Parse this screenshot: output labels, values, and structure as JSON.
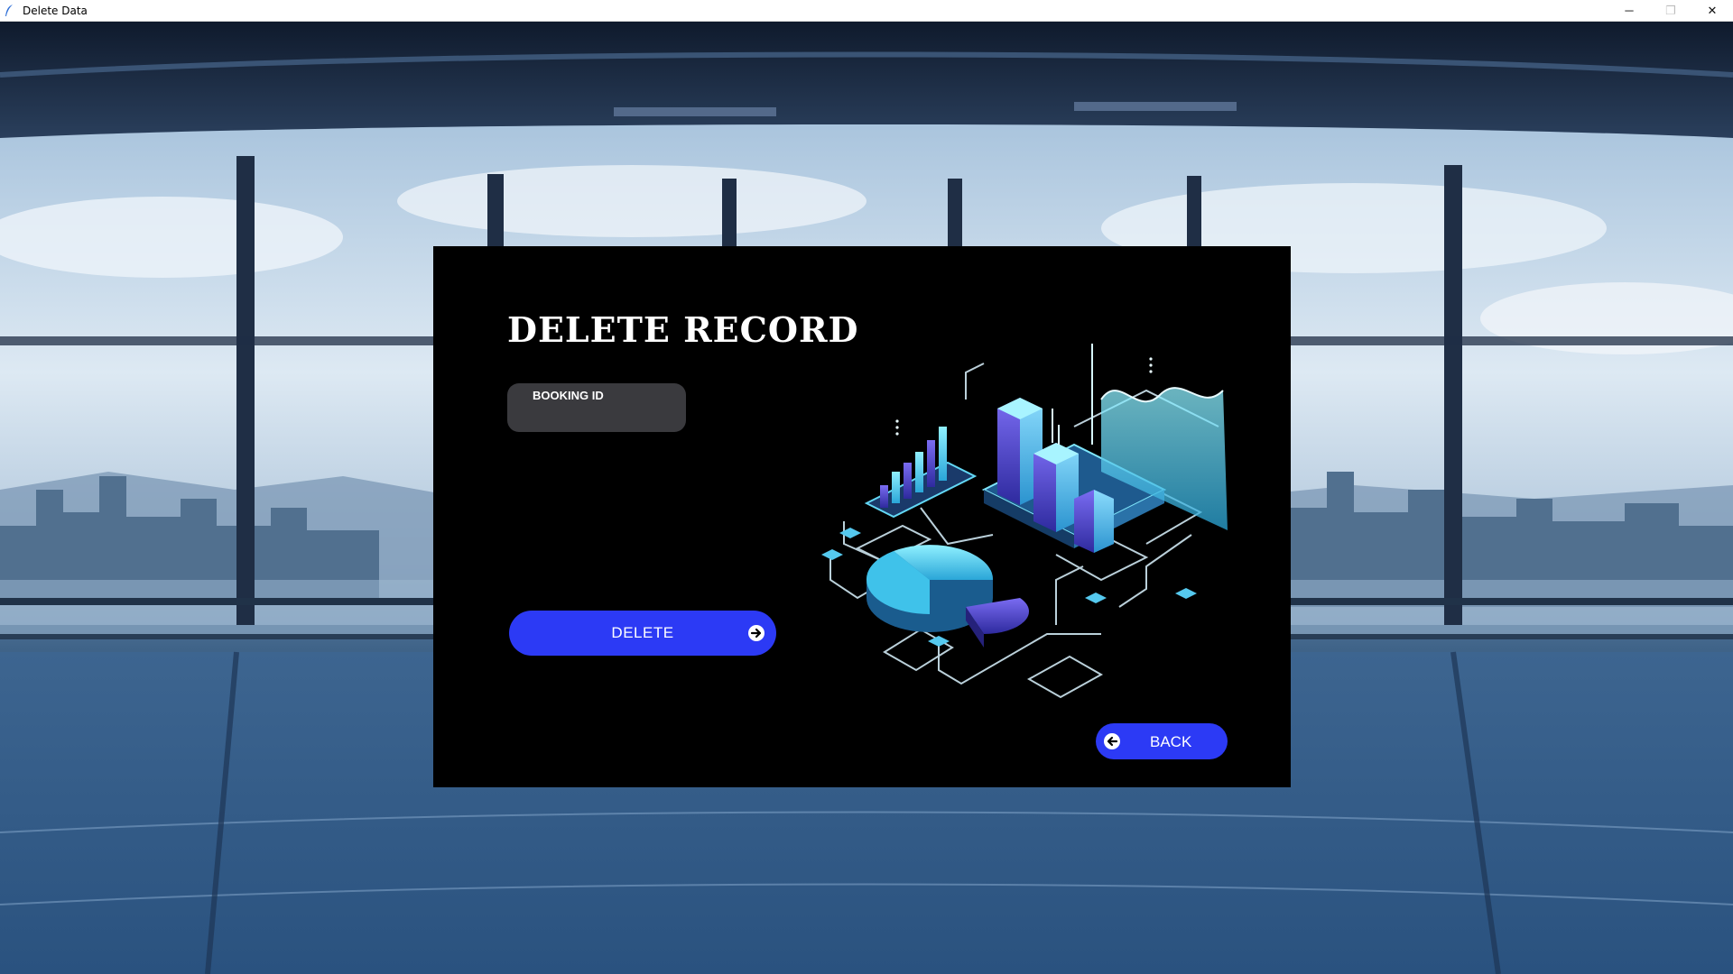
{
  "window": {
    "title": "Delete Data",
    "controls": {
      "minimize": "─",
      "maximize": "❐",
      "close": "✕"
    }
  },
  "panel": {
    "heading": "DELETE RECORD",
    "booking_field": {
      "label": "BOOKING ID",
      "value": ""
    },
    "delete_button": {
      "label": "DELETE",
      "icon": "arrow-right-circle-icon"
    },
    "back_button": {
      "label": "BACK",
      "icon": "arrow-left-circle-icon"
    }
  },
  "colors": {
    "panel_background": "#000000",
    "button_accent": "#2c3af5",
    "field_background": "#3a3a3e",
    "illustration_cyan": "#4fd6f2",
    "illustration_violet": "#6a4ff0"
  }
}
